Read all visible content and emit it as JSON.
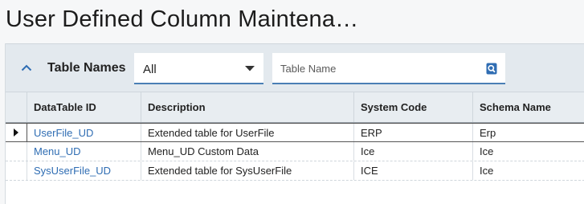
{
  "page": {
    "title": "User Defined Column Maintena…"
  },
  "toolbar": {
    "title": "Table Names",
    "collapse_icon": "chevron-up-icon",
    "filter_select": {
      "value": "All"
    },
    "search": {
      "placeholder": "Table Name",
      "value": ""
    },
    "accent_color": "#4a7fb5"
  },
  "grid": {
    "columns": [
      "DataTable ID",
      "Description",
      "System Code",
      "Schema Name"
    ],
    "rows": [
      {
        "id": "UserFile_UD",
        "description": "Extended table for UserFile",
        "system_code": "ERP",
        "schema": "Erp",
        "selected": true
      },
      {
        "id": "Menu_UD",
        "description": "Menu_UD Custom Data",
        "system_code": "Ice",
        "schema": "Ice",
        "selected": false
      },
      {
        "id": "SysUserFile_UD",
        "description": "Extended table for SysUserFile",
        "system_code": "ICE",
        "schema": "Ice",
        "selected": false
      }
    ],
    "link_color": "#2f6db3"
  }
}
